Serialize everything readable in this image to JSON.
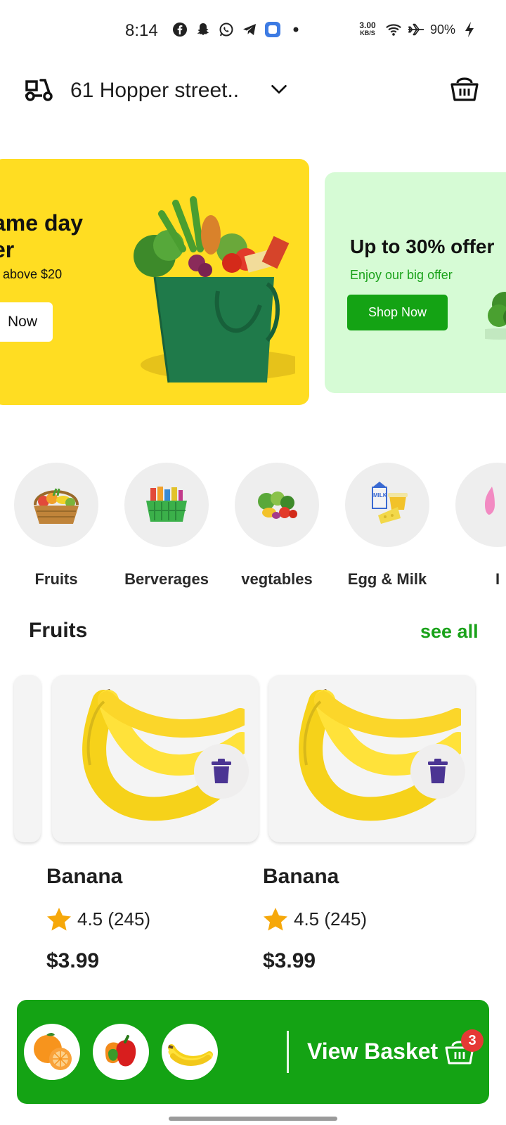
{
  "status_bar": {
    "time": "8:14",
    "net_speed_value": "3.00",
    "net_speed_unit": "KB/S",
    "battery": "90%"
  },
  "header": {
    "address": "61 Hopper street..",
    "icons": [
      "delivery-scooter-icon",
      "chevron-down-icon",
      "basket-icon"
    ]
  },
  "banners": [
    {
      "title": "ame day\ner",
      "subtitle": "s above $20",
      "button": "Now",
      "background": "#ffdd22"
    },
    {
      "title": "Up to 30% offer",
      "subtitle": "Enjoy our big offer",
      "button": "Shop Now",
      "background": "#d6fbd5",
      "accent": "#14a314"
    }
  ],
  "categories": [
    {
      "label": "Fruits",
      "icon": "fruit-basket-icon"
    },
    {
      "label": "Berverages",
      "icon": "beverage-basket-icon"
    },
    {
      "label": "vegtables",
      "icon": "vegetables-icon"
    },
    {
      "label": "Egg & Milk",
      "icon": "dairy-icon"
    },
    {
      "label": "I",
      "icon": "partial-category-icon"
    }
  ],
  "section": {
    "title": "Fruits",
    "see_all": "see all"
  },
  "products": [
    {
      "name": "Banana",
      "rating": "4.5 (245)",
      "price": "$3.99"
    },
    {
      "name": "Banana",
      "rating": "4.5 (245)",
      "price": "$3.99"
    }
  ],
  "basket_bar": {
    "label": "View Basket",
    "count": "3",
    "thumbnails": [
      "orange",
      "bell-pepper",
      "banana"
    ],
    "background": "#14a314"
  }
}
